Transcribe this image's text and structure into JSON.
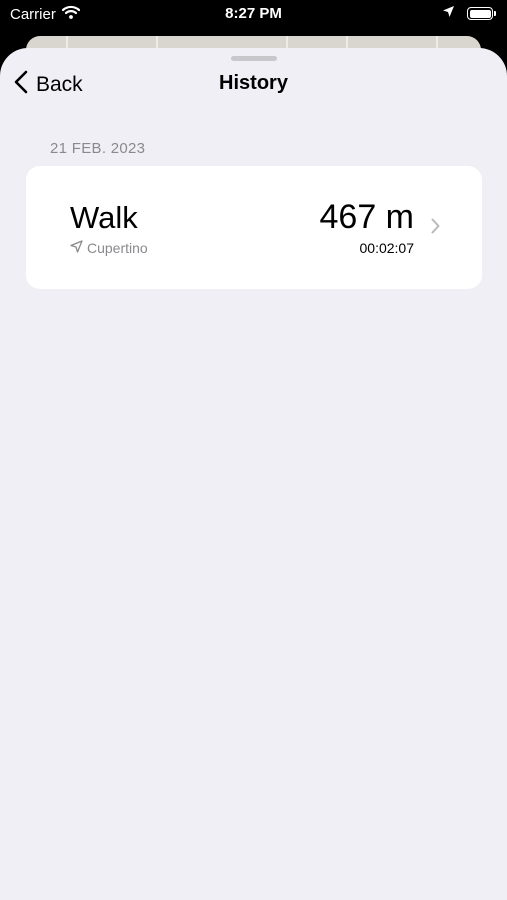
{
  "status_bar": {
    "carrier": "Carrier",
    "time": "8:27 PM"
  },
  "nav": {
    "back_label": "Back",
    "title": "History"
  },
  "history": {
    "sections": [
      {
        "date": "21 FEB. 2023",
        "entries": [
          {
            "activity": "Walk",
            "location": "Cupertino",
            "distance": "467 m",
            "duration": "00:02:07"
          }
        ]
      }
    ]
  },
  "icons": {
    "back": "chevron-left-icon",
    "location": "location-arrow-icon",
    "disclosure": "chevron-right-icon",
    "wifi": "wifi-icon",
    "gps": "location-services-icon",
    "battery": "battery-icon"
  },
  "colors": {
    "sheet_background": "#f0eff5",
    "card_background": "#ffffff",
    "secondary_text": "#8a8a8e",
    "grabber": "#c7c7cc"
  }
}
